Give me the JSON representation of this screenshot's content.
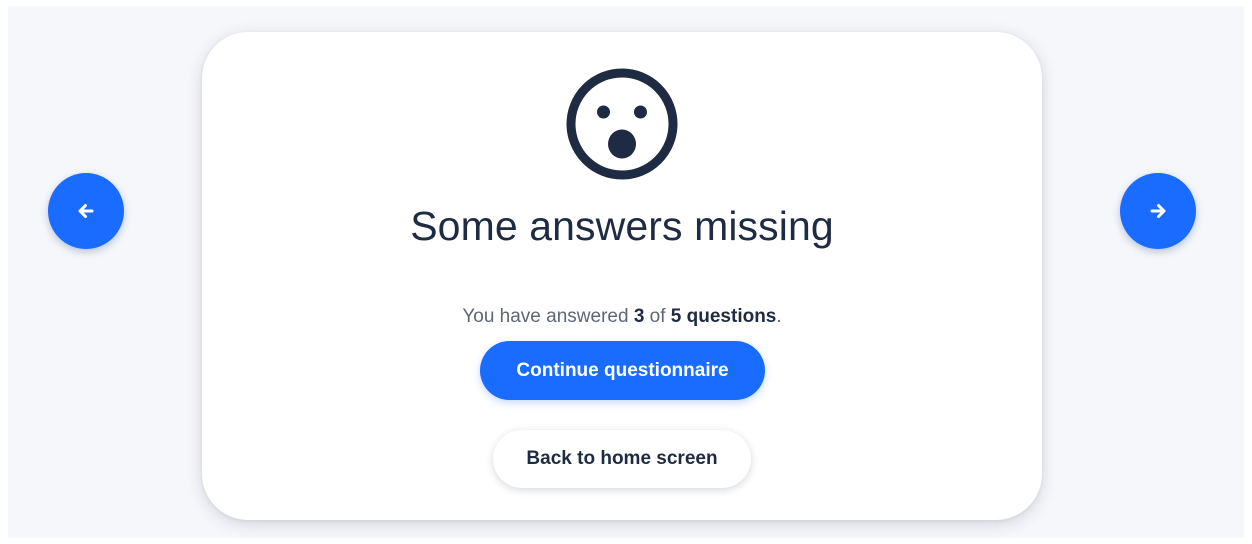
{
  "navigation": {
    "prev_icon": "arrow-left-icon",
    "next_icon": "arrow-right-icon"
  },
  "dialog": {
    "icon": "surprised-face-icon",
    "title": "Some answers missing",
    "message": {
      "prefix": "You have answered ",
      "answered": "3",
      "middle": " of ",
      "total": "5 questions",
      "suffix": "."
    },
    "primary_button": "Continue questionnaire",
    "secondary_button": "Back to home screen"
  },
  "colors": {
    "accent": "#1a6bff",
    "text_dark": "#1f2b43",
    "text_muted": "#5f6675",
    "background": "#f6f7fa"
  }
}
